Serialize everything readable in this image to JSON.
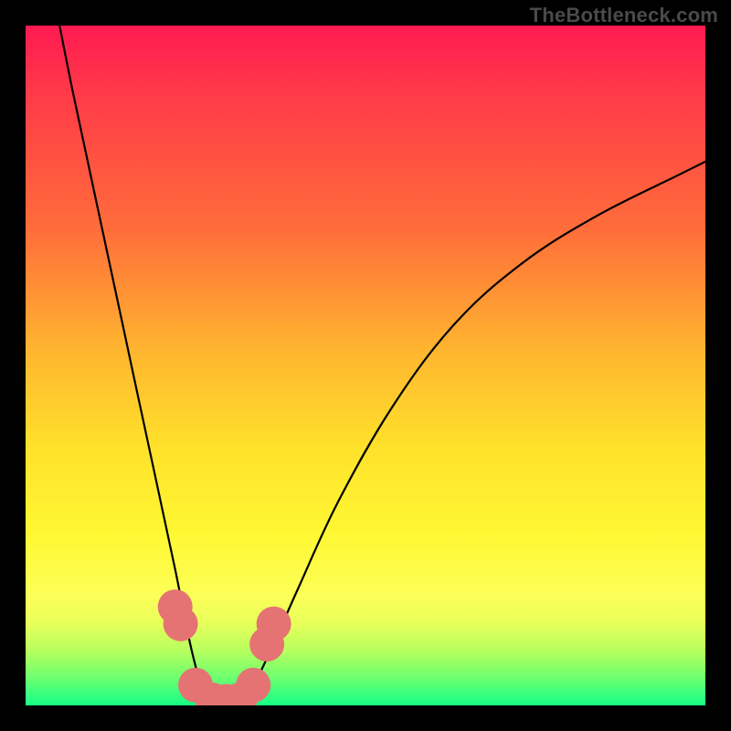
{
  "watermark": "TheBottleneck.com",
  "chart_data": {
    "type": "line",
    "title": "",
    "xlabel": "",
    "ylabel": "",
    "xlim": [
      0,
      100
    ],
    "ylim": [
      0,
      100
    ],
    "gradient_background": {
      "direction": "vertical",
      "stops": [
        {
          "pos": 0,
          "color": "#ff1a52"
        },
        {
          "pos": 30,
          "color": "#ff6d3a"
        },
        {
          "pos": 62,
          "color": "#ffe12a"
        },
        {
          "pos": 84,
          "color": "#fcff58"
        },
        {
          "pos": 100,
          "color": "#15ff86"
        }
      ]
    },
    "series": [
      {
        "name": "curve",
        "color": "#000000",
        "x": [
          5,
          7,
          10,
          13,
          16,
          19,
          22,
          24,
          25.5,
          27,
          29,
          31,
          33,
          36,
          40,
          46,
          54,
          63,
          73,
          84,
          96,
          100
        ],
        "y": [
          100,
          90,
          76,
          62,
          48,
          34,
          20,
          10,
          4,
          0,
          0,
          0,
          2,
          8,
          17,
          30,
          44,
          56,
          65,
          72,
          78,
          80
        ]
      }
    ],
    "markers": [
      {
        "name": "left-wall-dot-upper",
        "x": 22.0,
        "y": 14.5,
        "r": 1.6,
        "color": "#e57373"
      },
      {
        "name": "left-wall-dot-lower",
        "x": 22.8,
        "y": 12.0,
        "r": 1.6,
        "color": "#e57373"
      },
      {
        "name": "valley-left-dot-1",
        "x": 25.0,
        "y": 3.0,
        "r": 1.6,
        "color": "#e57373"
      },
      {
        "name": "valley-floor-dot-1",
        "x": 27.5,
        "y": 0.8,
        "r": 1.6,
        "color": "#e57373"
      },
      {
        "name": "valley-floor-dot-2",
        "x": 29.5,
        "y": 0.6,
        "r": 1.6,
        "color": "#e57373"
      },
      {
        "name": "valley-floor-dot-3",
        "x": 31.5,
        "y": 0.8,
        "r": 1.6,
        "color": "#e57373"
      },
      {
        "name": "valley-right-dot-1",
        "x": 33.5,
        "y": 3.0,
        "r": 1.6,
        "color": "#e57373"
      },
      {
        "name": "right-wall-dot-lower",
        "x": 35.5,
        "y": 9.0,
        "r": 1.6,
        "color": "#e57373"
      },
      {
        "name": "right-wall-dot-upper",
        "x": 36.5,
        "y": 12.0,
        "r": 1.6,
        "color": "#e57373"
      }
    ]
  }
}
